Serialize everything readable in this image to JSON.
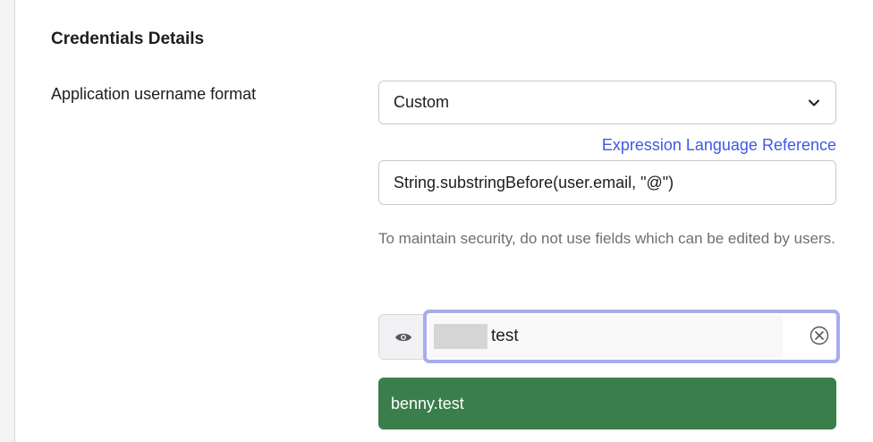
{
  "section": {
    "title": "Credentials Details"
  },
  "username_format": {
    "label": "Application username format",
    "select_value": "Custom",
    "link_text": "Expression Language Reference",
    "expression": "String.substringBefore(user.email, \"@\")",
    "help_text": "To maintain security, do not use fields which can be edited by users."
  },
  "preview": {
    "input_value": "test",
    "result": "benny.test"
  },
  "colors": {
    "link": "#3f59e4",
    "success": "#3a7e4c",
    "focus_ring": "#a7adea"
  },
  "icons": {
    "select": "chevron-down-icon",
    "reveal": "eye-icon",
    "clear": "clear-icon"
  }
}
